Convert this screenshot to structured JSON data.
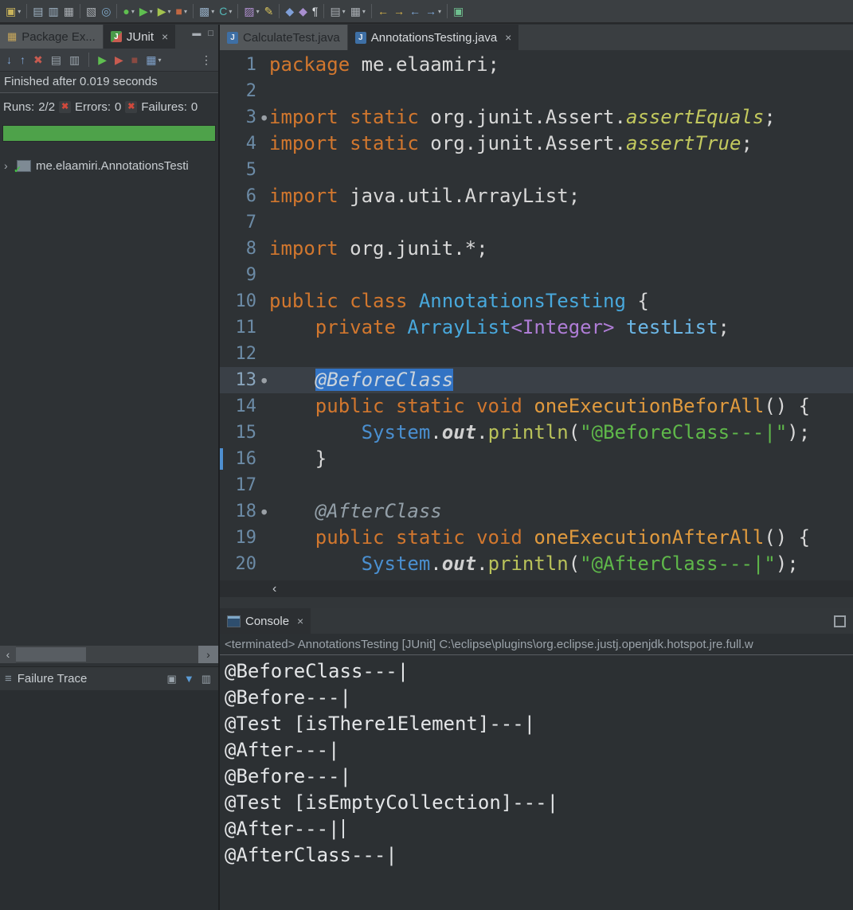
{
  "glyphs": {
    "close": "×",
    "minimize": "▬",
    "maximize": "□",
    "chevron_right": "›",
    "scroll_left": "‹",
    "scroll_right": "›",
    "menu": "≡",
    "dropdown": "▾",
    "cross": "✖",
    "package_icon": "▦",
    "java_letter": "J",
    "junit_letter": "J",
    "fold_dot": "●"
  },
  "toolbar": {
    "items": [
      {
        "name": "new-wizard-button",
        "glyph": "▣",
        "color": "#C9B35B",
        "dd": true
      },
      {
        "sep": true
      },
      {
        "name": "save-button",
        "glyph": "▤",
        "color": "#9FB3C4"
      },
      {
        "name": "save-all-button",
        "glyph": "▥",
        "color": "#9FB3C4"
      },
      {
        "name": "print-button",
        "glyph": "▦",
        "color": "#A9AEB3"
      },
      {
        "sep": true
      },
      {
        "name": "mail-button",
        "glyph": "▧",
        "color": "#A9AEB3"
      },
      {
        "name": "search-button",
        "glyph": "◎",
        "color": "#7FA8C8"
      },
      {
        "sep": true
      },
      {
        "name": "debug-button",
        "glyph": "●",
        "color": "#5FBF50",
        "dd": true
      },
      {
        "name": "run-button",
        "glyph": "▶",
        "color": "#5FBF50",
        "dd": true
      },
      {
        "name": "coverage-button",
        "glyph": "▶",
        "color": "#A3C34F",
        "dd": true
      },
      {
        "name": "external-tools-button",
        "glyph": "■",
        "color": "#C06742",
        "dd": true
      },
      {
        "sep": true
      },
      {
        "name": "new-java-project-button",
        "glyph": "▩",
        "color": "#8FA6BC",
        "dd": true
      },
      {
        "name": "new-java-class-button",
        "glyph": "C",
        "color": "#54B8B8",
        "dd": true
      },
      {
        "sep": true
      },
      {
        "name": "coverage-report-button",
        "glyph": "▨",
        "color": "#B08FD0",
        "dd": true
      },
      {
        "name": "format-button",
        "glyph": "✎",
        "color": "#D8C35C"
      },
      {
        "sep": true
      },
      {
        "name": "open-type-button",
        "glyph": "◆",
        "color": "#7F9FD8"
      },
      {
        "name": "open-task-button",
        "glyph": "◆",
        "color": "#A98FD0"
      },
      {
        "name": "show-whitespace-button",
        "glyph": "¶",
        "color": "#D8DCE0"
      },
      {
        "sep": true
      },
      {
        "name": "sort-button",
        "glyph": "▤",
        "color": "#A9AEB3",
        "dd": true
      },
      {
        "name": "hierarchy-button",
        "glyph": "▦",
        "color": "#A9AEB3",
        "dd": true
      },
      {
        "sep": true
      },
      {
        "name": "last-edit-location-button",
        "glyph": "←",
        "color": "#D8B44A"
      },
      {
        "name": "next-edit-location-button",
        "glyph": "→",
        "color": "#D8B44A"
      },
      {
        "name": "back-button",
        "glyph": "←",
        "color": "#7FA8D8"
      },
      {
        "name": "forward-button",
        "glyph": "→",
        "color": "#7FA8D8",
        "dd": true
      },
      {
        "sep": true
      },
      {
        "name": "perspective-button",
        "glyph": "▣",
        "color": "#6FBF8F"
      }
    ]
  },
  "left_panel": {
    "tabs": [
      {
        "label": "Package Ex...",
        "active": false
      },
      {
        "label": "JUnit",
        "active": true
      }
    ],
    "junit_toolbar": [
      {
        "name": "next-failed-test-button",
        "glyph": "↓",
        "color": "#7FA8D8"
      },
      {
        "name": "previous-failed-test-button",
        "glyph": "↑",
        "color": "#7FA8D8"
      },
      {
        "name": "rerun-failed-first-button",
        "glyph": "✖",
        "color": "#C85B50"
      },
      {
        "name": "show-failures-only-button",
        "glyph": "▤",
        "color": "#9AA4AC"
      },
      {
        "name": "show-skipped-only-button",
        "glyph": "▥",
        "color": "#9AA4AC"
      },
      {
        "sep": true
      },
      {
        "name": "rerun-test-button",
        "glyph": "▶",
        "color": "#5FBF50"
      },
      {
        "name": "rerun-failed-button",
        "glyph": "▶",
        "color": "#C85B50"
      },
      {
        "name": "stop-button",
        "glyph": "■",
        "color": "#8A4A42"
      },
      {
        "name": "test-run-history-button",
        "glyph": "▦",
        "color": "#7FA0C8",
        "dd": true
      },
      {
        "name": "view-menu-button",
        "glyph": "⋮",
        "color": "#C0C4C8",
        "pushright": true
      }
    ],
    "status_text": "Finished after 0.019 seconds",
    "runs": {
      "label": "Runs:",
      "value": "2/2",
      "errors_label": "Errors:",
      "errors_value": "0",
      "failures_label": "Failures:",
      "failures_value": "0"
    },
    "progress_percent": 100,
    "progress_color": "#4EA24A",
    "tree_item_label": "me.elaamiri.AnnotationsTesti",
    "failure_trace": {
      "label": "Failure Trace",
      "icons": [
        {
          "name": "show-stack-trace-console-button",
          "glyph": "▣",
          "color": "#9AA4AC"
        },
        {
          "name": "filter-stack-trace-button",
          "glyph": "▼",
          "color": "#5B9BD5"
        },
        {
          "name": "compare-results-button",
          "glyph": "▥",
          "color": "#9AA4AC"
        }
      ]
    }
  },
  "editor": {
    "tabs": [
      {
        "label": "CalculateTest.java",
        "active": false
      },
      {
        "label": "AnnotationsTesting.java",
        "active": true
      }
    ],
    "current_line": 13,
    "lines": [
      {
        "n": "1",
        "tokens": [
          [
            "kw",
            "package"
          ],
          [
            "pl",
            " me.elaamiri;"
          ]
        ]
      },
      {
        "n": "2",
        "tokens": []
      },
      {
        "n": "3",
        "dot": true,
        "tokens": [
          [
            "kw",
            "import static"
          ],
          [
            "pl",
            " org.junit.Assert."
          ],
          [
            "si",
            "assertEquals"
          ],
          [
            "pl",
            ";"
          ]
        ]
      },
      {
        "n": "4",
        "tokens": [
          [
            "kw",
            "import static"
          ],
          [
            "pl",
            " org.junit.Assert."
          ],
          [
            "si",
            "assertTrue"
          ],
          [
            "pl",
            ";"
          ]
        ]
      },
      {
        "n": "5",
        "tokens": []
      },
      {
        "n": "6",
        "tokens": [
          [
            "kw",
            "import"
          ],
          [
            "pl",
            " java.util.ArrayList;"
          ]
        ]
      },
      {
        "n": "7",
        "tokens": []
      },
      {
        "n": "8",
        "tokens": [
          [
            "kw",
            "import"
          ],
          [
            "pl",
            " org.junit.*;"
          ]
        ]
      },
      {
        "n": "9",
        "tokens": []
      },
      {
        "n": "10",
        "tokens": [
          [
            "kw",
            "public class"
          ],
          [
            "cls",
            " AnnotationsTesting"
          ],
          [
            "pl",
            " {"
          ]
        ]
      },
      {
        "n": "11",
        "tokens": [
          [
            "pl",
            "    "
          ],
          [
            "kw",
            "private"
          ],
          [
            "cls",
            " ArrayList"
          ],
          [
            "gen",
            "<Integer>"
          ],
          [
            "fld",
            " testList"
          ],
          [
            "pl",
            ";"
          ]
        ]
      },
      {
        "n": "12",
        "tokens": []
      },
      {
        "n": "13",
        "dot": true,
        "current": true,
        "tokens": [
          [
            "pl",
            "    "
          ],
          [
            "annsel",
            "@BeforeClass"
          ]
        ]
      },
      {
        "n": "14",
        "tokens": [
          [
            "pl",
            "    "
          ],
          [
            "kw",
            "public static void"
          ],
          [
            "mth",
            " oneExecutionBeforAll"
          ],
          [
            "pl",
            "() {"
          ]
        ]
      },
      {
        "n": "15",
        "tokens": [
          [
            "pl",
            "        "
          ],
          [
            "sys",
            "System"
          ],
          [
            "pl",
            "."
          ],
          [
            "out",
            "out"
          ],
          [
            "pl",
            "."
          ],
          [
            "fn",
            "println"
          ],
          [
            "pl",
            "("
          ],
          [
            "str",
            "\"@BeforeClass---|\""
          ],
          [
            "pl",
            ");"
          ]
        ]
      },
      {
        "n": "16",
        "changebar": true,
        "tokens": [
          [
            "pl",
            "    }"
          ]
        ]
      },
      {
        "n": "17",
        "tokens": []
      },
      {
        "n": "18",
        "dot": true,
        "tokens": [
          [
            "pl",
            "    "
          ],
          [
            "ann",
            "@AfterClass"
          ]
        ]
      },
      {
        "n": "19",
        "tokens": [
          [
            "pl",
            "    "
          ],
          [
            "kw",
            "public static void"
          ],
          [
            "mth",
            " oneExecutionAfterAll"
          ],
          [
            "pl",
            "() {"
          ]
        ]
      },
      {
        "n": "20",
        "tokens": [
          [
            "pl",
            "        "
          ],
          [
            "sys",
            "System"
          ],
          [
            "pl",
            "."
          ],
          [
            "out",
            "out"
          ],
          [
            "pl",
            "."
          ],
          [
            "fn",
            "println"
          ],
          [
            "pl",
            "("
          ],
          [
            "str",
            "\"@AfterClass---|\""
          ],
          [
            "pl",
            ");"
          ]
        ]
      }
    ]
  },
  "console": {
    "tab_label": "Console",
    "header": "<terminated> AnnotationsTesting [JUnit] C:\\eclipse\\plugins\\org.eclipse.justj.openjdk.hotspot.jre.full.w",
    "lines": [
      "@BeforeClass---|",
      "@Before---|",
      "@Test [isThere1Element]---|",
      "@After---|",
      "@Before---|",
      "@Test [isEmptyCollection]---|",
      "@After---|",
      "@AfterClass---|"
    ],
    "cursor_after_line": 7
  }
}
